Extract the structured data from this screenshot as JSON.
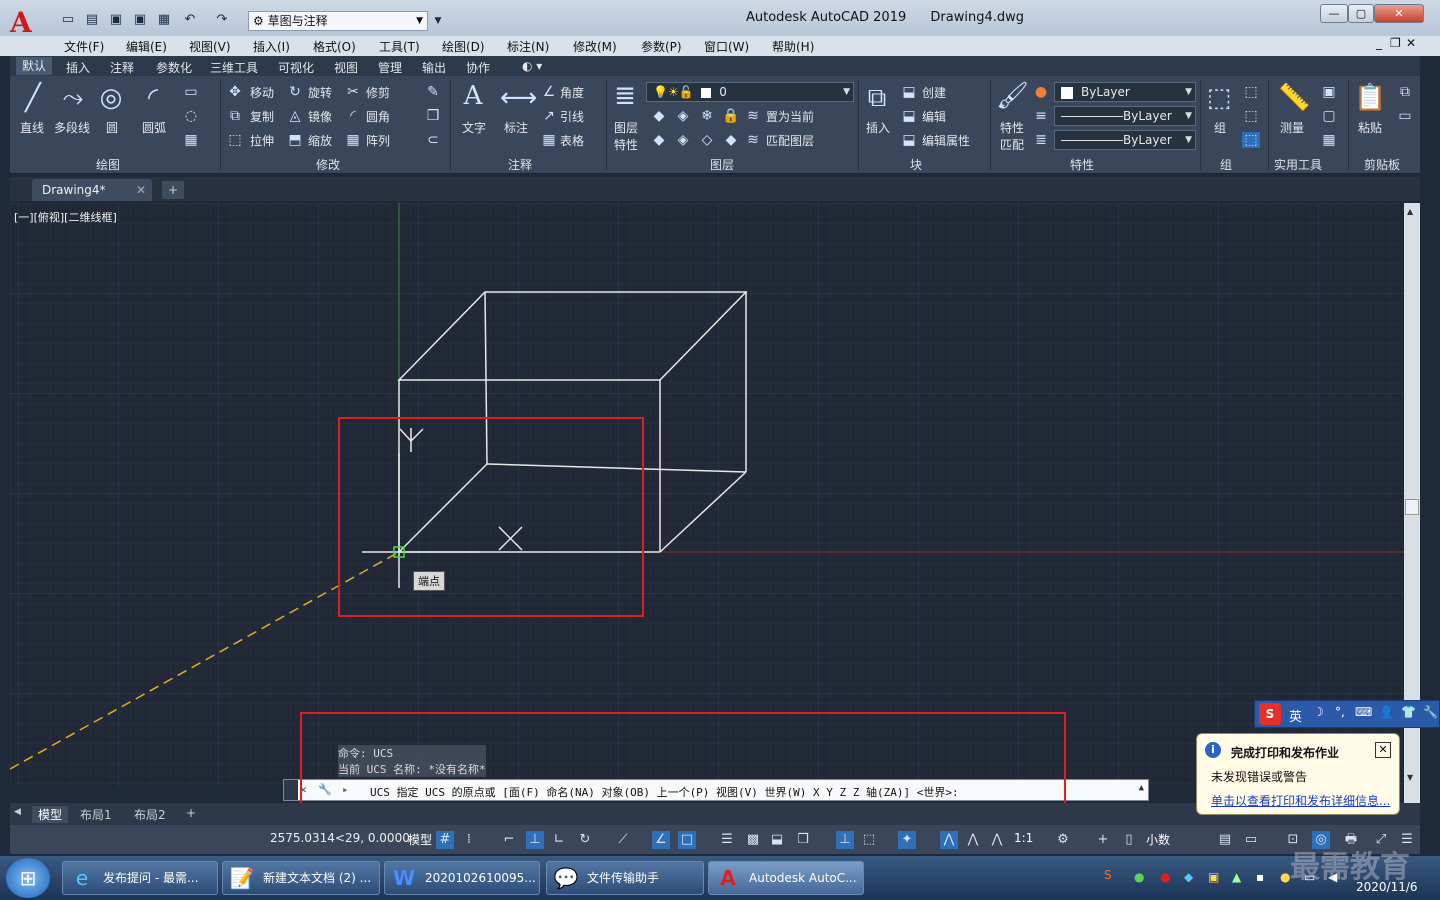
{
  "title_bar": {
    "app_title": "Autodesk AutoCAD 2019",
    "file_name": "Drawing4.dwg",
    "workspace": "草图与注释",
    "logo_letter": "A"
  },
  "menu": [
    "文件(F)",
    "编辑(E)",
    "视图(V)",
    "插入(I)",
    "格式(O)",
    "工具(T)",
    "绘图(D)",
    "标注(N)",
    "修改(M)",
    "参数(P)",
    "窗口(W)",
    "帮助(H)"
  ],
  "ribbon_tabs": [
    "默认",
    "插入",
    "注释",
    "参数化",
    "三维工具",
    "可视化",
    "视图",
    "管理",
    "输出",
    "协作"
  ],
  "ribbon": {
    "draw": {
      "line": "直线",
      "polyline": "多段线",
      "circle": "圆",
      "arc": "圆弧",
      "label": "绘图"
    },
    "modify": {
      "move": "移动",
      "rotate": "旋转",
      "trim": "修剪",
      "copy": "复制",
      "mirror": "镜像",
      "fillet": "圆角",
      "stretch": "拉伸",
      "scale": "缩放",
      "array": "阵列",
      "label": "修改"
    },
    "annotation": {
      "text": "文字",
      "dimension": "标注",
      "angle": "角度",
      "leader": "引线",
      "table": "表格",
      "label": "注释"
    },
    "layers": {
      "layer_props_1": "图层",
      "layer_props_2": "特性",
      "current_layer": "0",
      "set_current": "置为当前",
      "match_layer": "匹配图层",
      "label": "图层"
    },
    "block": {
      "insert": "插入",
      "create": "创建",
      "edit": "编辑",
      "edit_attr": "编辑属性",
      "label": "块"
    },
    "properties": {
      "match_1": "特性",
      "match_2": "匹配",
      "color": "ByLayer",
      "linetype": "ByLayer",
      "lineweight": "ByLayer",
      "label": "特性"
    },
    "group": {
      "label_top": "组",
      "label": "组"
    },
    "utilities": {
      "measure": "测量",
      "label": "实用工具"
    },
    "clipboard": {
      "paste": "粘贴",
      "label": "剪贴板"
    }
  },
  "doc_tab": "Drawing4*",
  "viewport_label": "[一][俯视][二维线框]",
  "osnap_tooltip": "端点",
  "command": {
    "history_1": "命令: UCS",
    "history_2": "当前 UCS 名称: *没有名称*",
    "prompt": "UCS 指定 UCS 的原点或 [面(F) 命名(NA) 对象(OB) 上一个(P) 视图(V) 世界(W) X Y Z Z 轴(ZA)] <世界>:"
  },
  "layout_tabs": [
    "模型",
    "布局1",
    "布局2"
  ],
  "status": {
    "coords": "2575.0314<29, 0.0000",
    "model": "模型",
    "scale": "1:1",
    "units": "小数"
  },
  "notification": {
    "title": "完成打印和发布作业",
    "line1": "未发现错误或警告",
    "link": "单击以查看打印和发布详细信息..."
  },
  "ime": {
    "mode": "英"
  },
  "taskbar": {
    "items": [
      "发布提问 - 最需...",
      "新建文本文档 (2) ...",
      "2020102610095...",
      "文件传输助手",
      "Autodesk AutoC..."
    ],
    "date": "2020/11/6"
  },
  "watermark": "最需教育",
  "colors": {
    "canvas": "#212836",
    "ribbon": "#3a475a",
    "highlight": "#e01e1e",
    "axis_green": "#3a8a3a",
    "axis_red": "#8a2a2a"
  }
}
